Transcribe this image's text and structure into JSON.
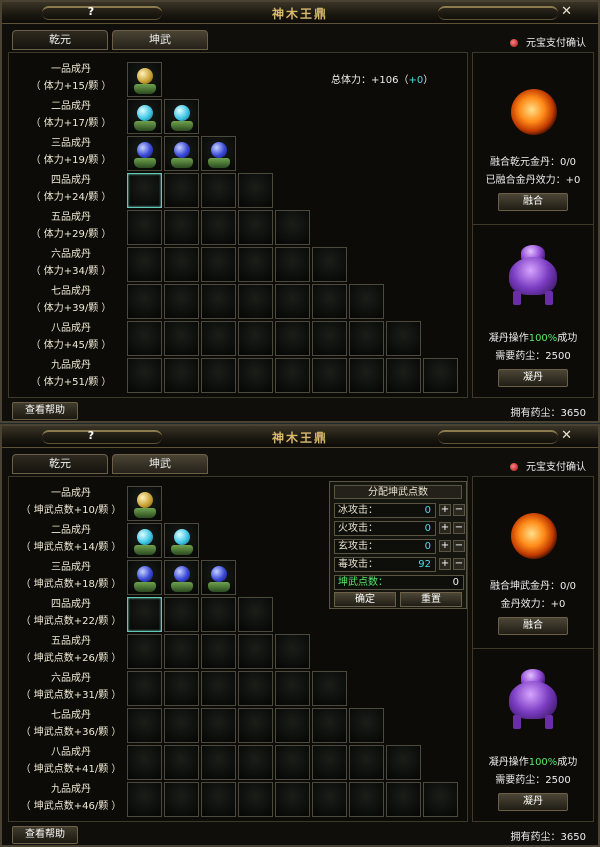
{
  "top": {
    "title": "神木王鼎",
    "help": "?",
    "close": "✕",
    "tabs": [
      "乾元",
      "坤武"
    ],
    "pay_confirm": "元宝支付确认",
    "total_hp_prefix": "总体力：+106（",
    "total_hp_bonus": "+0",
    "total_hp_suffix": "）",
    "rows": [
      {
        "name": "一品成丹",
        "bonus": "（ 体力+15/颗 ）"
      },
      {
        "name": "二品成丹",
        "bonus": "（ 体力+17/颗 ）"
      },
      {
        "name": "三品成丹",
        "bonus": "（ 体力+19/颗 ）"
      },
      {
        "name": "四品成丹",
        "bonus": "（ 体力+24/颗 ）"
      },
      {
        "name": "五品成丹",
        "bonus": "（ 体力+29/颗 ）"
      },
      {
        "name": "六品成丹",
        "bonus": "（ 体力+34/颗 ）"
      },
      {
        "name": "七品成丹",
        "bonus": "（ 体力+39/颗 ）"
      },
      {
        "name": "八品成丹",
        "bonus": "（ 体力+45/颗 ）"
      },
      {
        "name": "九品成丹",
        "bonus": "（ 体力+51/颗 ）"
      }
    ],
    "fuse_line1": "融合乾元金丹：0/0",
    "fuse_line2": "已融合金丹效力：+0",
    "fuse_btn": "融合",
    "craft_prefix": "凝丹操作",
    "craft_rate": "100%",
    "craft_suffix": "成功",
    "dust_need": "需要药尘：2500",
    "craft_btn": "凝丹",
    "help_btn": "查看帮助",
    "owned_dust": "拥有药尘：3650"
  },
  "bottom": {
    "title": "神木王鼎",
    "help": "?",
    "close": "✕",
    "tabs": [
      "乾元",
      "坤武"
    ],
    "pay_confirm": "元宝支付确认",
    "rows": [
      {
        "name": "一品成丹",
        "bonus": "（ 坤武点数+10/颗 ）"
      },
      {
        "name": "二品成丹",
        "bonus": "（ 坤武点数+14/颗 ）"
      },
      {
        "name": "三品成丹",
        "bonus": "（ 坤武点数+18/颗 ）"
      },
      {
        "name": "四品成丹",
        "bonus": "（ 坤武点数+22/颗 ）"
      },
      {
        "name": "五品成丹",
        "bonus": "（ 坤武点数+26/颗 ）"
      },
      {
        "name": "六品成丹",
        "bonus": "（ 坤武点数+31/颗 ）"
      },
      {
        "name": "七品成丹",
        "bonus": "（ 坤武点数+36/颗 ）"
      },
      {
        "name": "八品成丹",
        "bonus": "（ 坤武点数+41/颗 ）"
      },
      {
        "name": "九品成丹",
        "bonus": "（ 坤武点数+46/颗 ）"
      }
    ],
    "alloc": {
      "title": "分配坤武点数",
      "rows": [
        {
          "label": "冰攻击：",
          "value": "0"
        },
        {
          "label": "火攻击：",
          "value": "0"
        },
        {
          "label": "玄攻击：",
          "value": "0"
        },
        {
          "label": "毒攻击：",
          "value": "92"
        }
      ],
      "points_label": "坤武点数：",
      "points_value": "0",
      "plus": "+",
      "minus": "−",
      "confirm": "确定",
      "reset": "重置"
    },
    "fuse_line1": "融合坤武金丹：0/0",
    "fuse_line2": "金丹效力：+0",
    "fuse_btn": "融合",
    "craft_prefix": "凝丹操作",
    "craft_rate": "100%",
    "craft_suffix": "成功",
    "dust_need": "需要药尘：2500",
    "craft_btn": "凝丹",
    "help_btn": "查看帮助",
    "owned_dust": "拥有药尘：3650"
  },
  "grid": {
    "filled": [
      [
        "gold"
      ],
      [
        "cyan",
        "cyan"
      ],
      [
        "blue",
        "blue",
        "blue"
      ]
    ],
    "highlight_row": 3,
    "colors": {
      "gold": "#c49a2c",
      "cyan": "#3ec6e6",
      "blue": "#3848d6",
      "highlight": "#5fc9b6",
      "accent": "#56e86b"
    }
  }
}
